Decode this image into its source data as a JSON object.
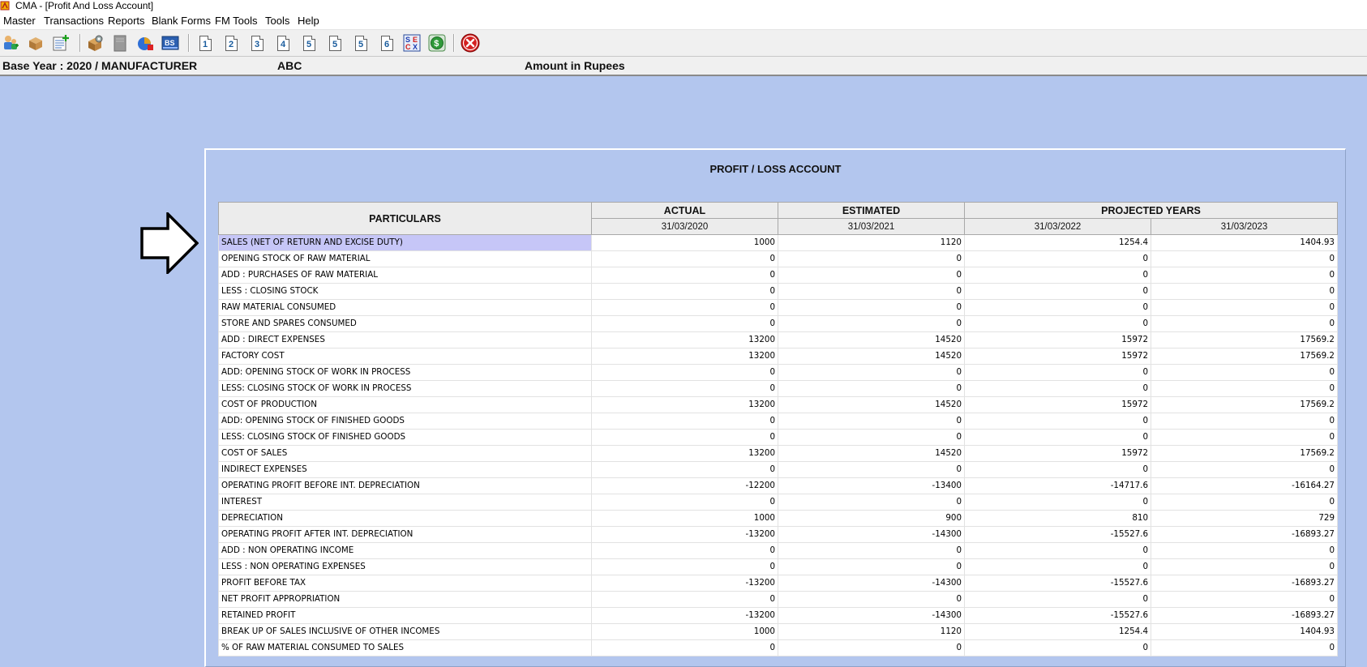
{
  "window": {
    "title": "CMA - [Profit And Loss Account]"
  },
  "menu": [
    "Master",
    "Transactions",
    "Reports",
    "Blank Forms",
    "FM Tools",
    "Tools",
    "Help"
  ],
  "toolbar": {
    "icons": [
      "users-icon",
      "boxes-icon",
      "add-document-icon",
      "settings-package-icon",
      "gray-page-icon",
      "chart-icon",
      "bs-report-icon"
    ],
    "page_buttons": [
      "1",
      "2",
      "3",
      "4",
      "5",
      "5",
      "5",
      "6"
    ],
    "extra_icons": [
      "sec-icon",
      "dollar-icon"
    ],
    "close_icon": "close-icon"
  },
  "info": {
    "base_year": "Base Year : 2020 / MANUFACTURER",
    "company": "ABC",
    "amount_unit": "Amount in Rupees"
  },
  "report": {
    "title": "PROFIT / LOSS ACCOUNT",
    "header": {
      "particulars": "PARTICULARS",
      "actual": "ACTUAL",
      "estimated": "ESTIMATED",
      "projected": "PROJECTED YEARS",
      "dates": [
        "31/03/2020",
        "31/03/2021",
        "31/03/2022",
        "31/03/2023"
      ]
    },
    "rows": [
      {
        "label": "SALES (NET OF RETURN AND EXCISE DUTY)",
        "values": [
          "1000",
          "1120",
          "1254.4",
          "1404.93"
        ]
      },
      {
        "label": "OPENING STOCK OF RAW MATERIAL",
        "values": [
          "0",
          "0",
          "0",
          "0"
        ]
      },
      {
        "label": "ADD : PURCHASES OF RAW MATERIAL",
        "values": [
          "0",
          "0",
          "0",
          "0"
        ]
      },
      {
        "label": "LESS : CLOSING STOCK",
        "values": [
          "0",
          "0",
          "0",
          "0"
        ]
      },
      {
        "label": "RAW MATERIAL CONSUMED",
        "values": [
          "0",
          "0",
          "0",
          "0"
        ]
      },
      {
        "label": "STORE AND SPARES CONSUMED",
        "values": [
          "0",
          "0",
          "0",
          "0"
        ]
      },
      {
        "label": "ADD : DIRECT EXPENSES",
        "values": [
          "13200",
          "14520",
          "15972",
          "17569.2"
        ]
      },
      {
        "label": "FACTORY COST",
        "values": [
          "13200",
          "14520",
          "15972",
          "17569.2"
        ]
      },
      {
        "label": "ADD: OPENING STOCK OF WORK IN PROCESS",
        "values": [
          "0",
          "0",
          "0",
          "0"
        ]
      },
      {
        "label": "LESS: CLOSING STOCK OF WORK IN PROCESS",
        "values": [
          "0",
          "0",
          "0",
          "0"
        ]
      },
      {
        "label": "COST OF PRODUCTION",
        "values": [
          "13200",
          "14520",
          "15972",
          "17569.2"
        ]
      },
      {
        "label": "ADD: OPENING STOCK OF FINISHED GOODS",
        "values": [
          "0",
          "0",
          "0",
          "0"
        ]
      },
      {
        "label": "LESS: CLOSING STOCK OF FINISHED GOODS",
        "values": [
          "0",
          "0",
          "0",
          "0"
        ]
      },
      {
        "label": "COST OF SALES",
        "values": [
          "13200",
          "14520",
          "15972",
          "17569.2"
        ]
      },
      {
        "label": "INDIRECT EXPENSES",
        "values": [
          "0",
          "0",
          "0",
          "0"
        ]
      },
      {
        "label": "OPERATING PROFIT BEFORE INT. DEPRECIATION",
        "values": [
          "-12200",
          "-13400",
          "-14717.6",
          "-16164.27"
        ]
      },
      {
        "label": "INTEREST",
        "values": [
          "0",
          "0",
          "0",
          "0"
        ]
      },
      {
        "label": "DEPRECIATION",
        "values": [
          "1000",
          "900",
          "810",
          "729"
        ]
      },
      {
        "label": "OPERATING PROFIT AFTER INT. DEPRECIATION",
        "values": [
          "-13200",
          "-14300",
          "-15527.6",
          "-16893.27"
        ]
      },
      {
        "label": "ADD : NON OPERATING INCOME",
        "values": [
          "0",
          "0",
          "0",
          "0"
        ]
      },
      {
        "label": "LESS : NON OPERATING EXPENSES",
        "values": [
          "0",
          "0",
          "0",
          "0"
        ]
      },
      {
        "label": "PROFIT BEFORE TAX",
        "values": [
          "-13200",
          "-14300",
          "-15527.6",
          "-16893.27"
        ]
      },
      {
        "label": "NET PROFIT APPROPRIATION",
        "values": [
          "0",
          "0",
          "0",
          "0"
        ]
      },
      {
        "label": "RETAINED PROFIT",
        "values": [
          "-13200",
          "-14300",
          "-15527.6",
          "-16893.27"
        ]
      },
      {
        "label": "BREAK UP OF SALES INCLUSIVE OF OTHER INCOMES",
        "values": [
          "1000",
          "1120",
          "1254.4",
          "1404.93"
        ]
      },
      {
        "label": "% OF RAW MATERIAL CONSUMED TO SALES",
        "values": [
          "0",
          "0",
          "0",
          "0"
        ]
      }
    ]
  },
  "colors": {
    "workspace": "#b3c6ee",
    "selected_cell": "#c6c6f7",
    "close_button": "#d42020"
  }
}
